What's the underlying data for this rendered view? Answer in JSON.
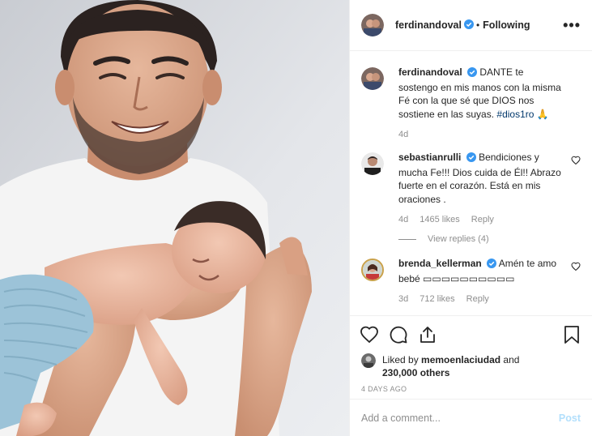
{
  "post": {
    "author": "ferdinandoval",
    "follow_status": "Following",
    "more_label": "•••"
  },
  "caption": {
    "username": "ferdinandoval",
    "text": "DANTE te sostengo en mis manos con la misma Fé con la que sé que DIOS nos sostiene en las suyas.",
    "hashtag": "#dios1ro",
    "emoji": "🙏",
    "time": "4d"
  },
  "comments": [
    {
      "username": "sebastianrulli",
      "text": "Bendiciones y mucha Fe!!! Dios cuida de Él!! Abrazo fuerte en el corazón. Está en mis oraciones .",
      "time": "4d",
      "likes": "1465 likes",
      "reply_label": "Reply",
      "view_replies": "View replies (4)"
    },
    {
      "username": "brenda_kellerman",
      "text": "Amén te amo bebé ▭▭▭▭▭▭▭▭▭▭",
      "time": "3d",
      "likes": "712 likes",
      "reply_label": "Reply"
    }
  ],
  "likes": {
    "prefix": "Liked by",
    "user": "memoenlaciudad",
    "joiner": "and",
    "others": "230,000 others"
  },
  "date": "4 DAYS AGO",
  "add_comment": {
    "placeholder": "Add a comment...",
    "post_label": "Post"
  },
  "icons": [
    "heart-icon",
    "comment-icon",
    "share-icon",
    "bookmark-icon",
    "verified-badge-icon",
    "more-options-icon"
  ],
  "colors": {
    "verified": "#3897f0",
    "link": "#00376b",
    "muted": "#8e8e8e",
    "post_button": "#b2dffc"
  }
}
